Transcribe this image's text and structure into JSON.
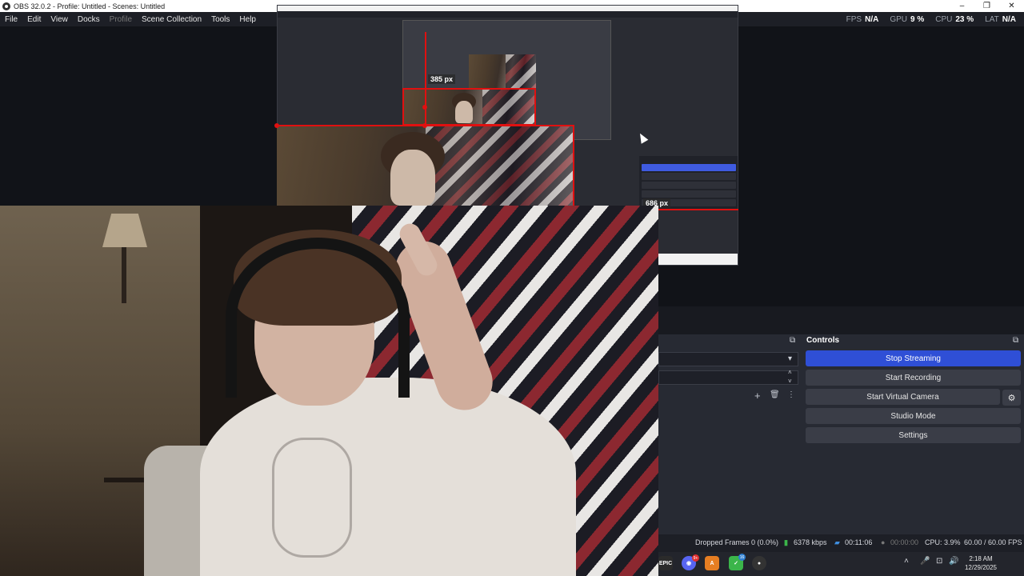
{
  "window": {
    "title": "OBS 32.0.2 - Profile: Untitled - Scenes: Untitled",
    "controls": [
      "–",
      "❐",
      "✕"
    ]
  },
  "menu": {
    "items": [
      "File",
      "Edit",
      "View",
      "Docks",
      "Profile",
      "Scene Collection",
      "Tools",
      "Help"
    ]
  },
  "stats": {
    "fps_label": "FPS",
    "fps_value": "N/A",
    "gpu_label": "GPU",
    "gpu_value": "9 %",
    "cpu_label": "CPU",
    "cpu_value": "23 %",
    "lat_label": "LAT",
    "lat_value": "N/A"
  },
  "preview": {
    "measure_top": "385 px",
    "measure_right": "686 px"
  },
  "docks": {
    "controls_title": "Controls",
    "buttons": {
      "stop_streaming": "Stop Streaming",
      "start_recording": "Start Recording",
      "start_virtual_camera": "Start Virtual Camera",
      "studio_mode": "Studio Mode",
      "settings": "Settings"
    },
    "icons": {
      "popout": "⧉",
      "dropdown": "▾",
      "spin_up": "˄",
      "spin_down": "˅",
      "add": "+",
      "trash": "🗑",
      "more": "⋮",
      "gear": "⚙"
    }
  },
  "status": {
    "dropped_frames": "Dropped Frames 0 (0.0%)",
    "bitrate": "6378 kbps",
    "stream_time": "00:11:06",
    "rec_time": "00:00:00",
    "cpu": "CPU: 3.9%",
    "fps": "60.00 / 60.00 FPS"
  },
  "taskbar": {
    "apps": [
      {
        "name": "EPIC",
        "color": "#2b2b2b",
        "badge": ""
      },
      {
        "name": "◉",
        "color": "#5865f2",
        "badge": "9+"
      },
      {
        "name": "A",
        "color": "#e67e22",
        "badge": ""
      },
      {
        "name": "✓",
        "color": "#3bb54a",
        "badge": "16"
      },
      {
        "name": "●",
        "color": "#333333",
        "badge": ""
      }
    ],
    "tray_icons": [
      "˄",
      "🎤",
      "⊡",
      "🔊"
    ],
    "time": "2:18 AM",
    "date": "12/29/2025"
  }
}
